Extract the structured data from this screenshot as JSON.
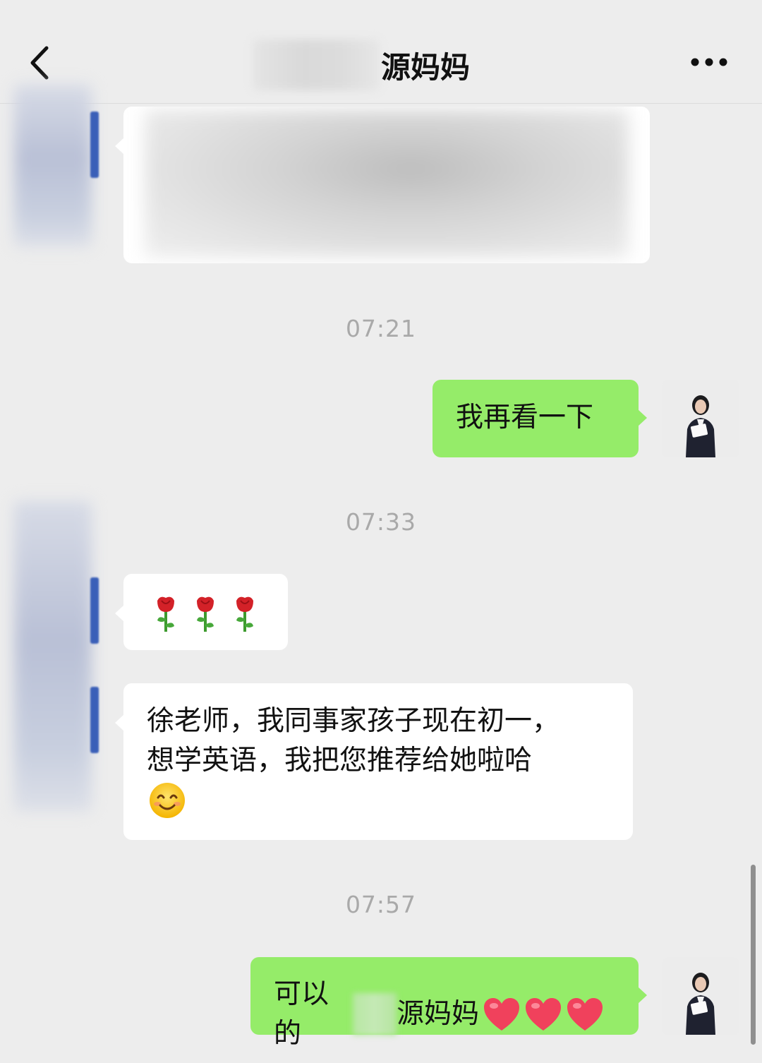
{
  "header": {
    "title": "源妈妈",
    "back_icon": "chevron-left-icon",
    "more_icon": "more-dots-icon"
  },
  "timestamps": [
    "07:21",
    "07:33",
    "07:57"
  ],
  "messages": {
    "m2": {
      "text": "我再看一下"
    },
    "m4": {
      "text": "徐老师，我同事家孩子现在初一，\n想学英语，我把您推荐给她啦哈"
    },
    "m5": {
      "prefix": "可以的",
      "suffix": "源妈妈"
    }
  },
  "colors": {
    "background": "#ededed",
    "incoming_bubble": "#ffffff",
    "outgoing_bubble": "#95ec69",
    "timestamp": "#a9a9a9"
  },
  "icons": {
    "rose": "rose-emoji-icon",
    "smile": "smiling-face-emoji-icon",
    "heart": "red-heart-emoji-icon"
  }
}
